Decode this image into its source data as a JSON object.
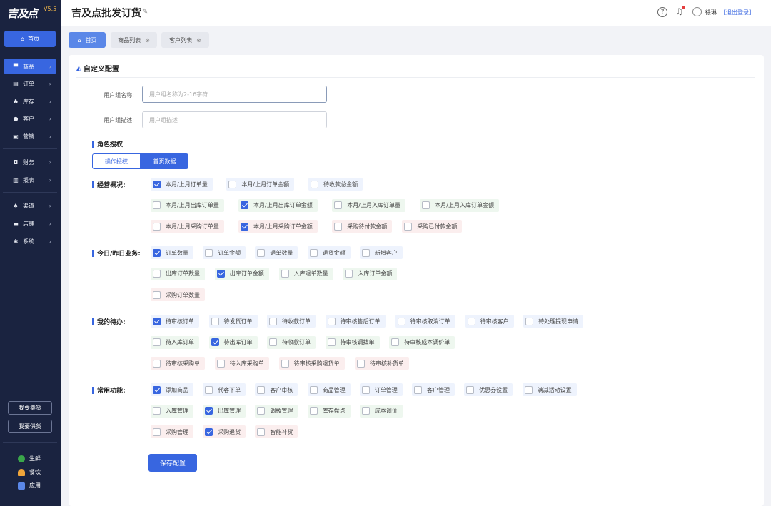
{
  "app": {
    "logo": "吉及点",
    "version": "V5.5"
  },
  "header": {
    "title": "吉及点批发订货",
    "user": "徐琳",
    "logout": "【退出登录】"
  },
  "sidebar": {
    "home": "首页",
    "items": [
      {
        "label": "商品",
        "icon": "cart-icon"
      },
      {
        "label": "订单",
        "icon": "order-icon"
      },
      {
        "label": "库存",
        "icon": "stock-icon"
      },
      {
        "label": "客户",
        "icon": "customer-icon"
      },
      {
        "label": "营销",
        "icon": "marketing-icon"
      },
      {
        "label": "财务",
        "icon": "finance-icon"
      },
      {
        "label": "报表",
        "icon": "report-icon"
      },
      {
        "label": "渠道",
        "icon": "channel-icon"
      },
      {
        "label": "店铺",
        "icon": "shop-icon"
      },
      {
        "label": "系统",
        "icon": "settings-icon"
      }
    ],
    "buttons": [
      "我要卖货",
      "我要供货"
    ],
    "apps": [
      "生鲜",
      "餐饮",
      "应用"
    ]
  },
  "tabs": [
    {
      "label": "首页"
    },
    {
      "label": "商品列表"
    },
    {
      "label": "客户列表"
    }
  ],
  "card": {
    "title": "自定义配置",
    "form": {
      "name_label": "用户组名称:",
      "name_placeholder": "用户组名称为2-16字符",
      "desc_label": "用户组描述:",
      "desc_placeholder": "用户组描述"
    },
    "role_title": "角色授权",
    "segments": [
      "操作授权",
      "首页数据"
    ],
    "save": "保存配置"
  },
  "groups": [
    {
      "label": "经营概况:",
      "rows": [
        {
          "color": "blue",
          "items": [
            {
              "label": "本月/上月订单量",
              "checked": true
            },
            {
              "label": "本月/上月订单金额",
              "checked": false
            },
            {
              "label": "待收款总金额",
              "checked": false
            }
          ]
        },
        {
          "color": "green",
          "items": [
            {
              "label": "本月/上月出库订单量",
              "checked": false
            },
            {
              "label": "本月/上月出库订单金额",
              "checked": true
            },
            {
              "label": "本月/上月入库订单量",
              "checked": false
            },
            {
              "label": "本月/上月入库订单金额",
              "checked": false
            }
          ]
        },
        {
          "color": "red",
          "items": [
            {
              "label": "本月/上月采购订单量",
              "checked": false
            },
            {
              "label": "本月/上月采购订单金额",
              "checked": true
            },
            {
              "label": "采购待付款金额",
              "checked": false
            },
            {
              "label": "采购已付款金额",
              "checked": false
            }
          ]
        }
      ]
    },
    {
      "label": "今日/昨日业务:",
      "rows": [
        {
          "color": "blue",
          "items": [
            {
              "label": "订单数量",
              "checked": true
            },
            {
              "label": "订单金额",
              "checked": false
            },
            {
              "label": "退单数量",
              "checked": false
            },
            {
              "label": "退货金额",
              "checked": false
            },
            {
              "label": "新增客户",
              "checked": false
            }
          ]
        },
        {
          "color": "green",
          "items": [
            {
              "label": "出库订单数量",
              "checked": false
            },
            {
              "label": "出库订单金额",
              "checked": true
            },
            {
              "label": "入库退单数量",
              "checked": false
            },
            {
              "label": "入库订单金额",
              "checked": false
            }
          ]
        },
        {
          "color": "red",
          "items": [
            {
              "label": "采购订单数量",
              "checked": false
            }
          ]
        }
      ]
    },
    {
      "label": "我的待办:",
      "rows": [
        {
          "color": "blue",
          "items": [
            {
              "label": "待审核订单",
              "checked": true
            },
            {
              "label": "待发货订单",
              "checked": false
            },
            {
              "label": "待收款订单",
              "checked": false
            },
            {
              "label": "待审核售后订单",
              "checked": false
            },
            {
              "label": "待审核取消订单",
              "checked": false
            },
            {
              "label": "待审核客户",
              "checked": false
            },
            {
              "label": "待处理提现申请",
              "checked": false
            }
          ]
        },
        {
          "color": "green",
          "items": [
            {
              "label": "待入库订单",
              "checked": false
            },
            {
              "label": "待出库订单",
              "checked": true
            },
            {
              "label": "待收款订单",
              "checked": false
            },
            {
              "label": "待审核调拨单",
              "checked": false
            },
            {
              "label": "待审核成本调价单",
              "checked": false
            }
          ]
        },
        {
          "color": "red",
          "items": [
            {
              "label": "待审核采购单",
              "checked": false
            },
            {
              "label": "待入库采购单",
              "checked": false
            },
            {
              "label": "待审核采购退货单",
              "checked": false
            },
            {
              "label": "待审核补货单",
              "checked": false
            }
          ]
        }
      ]
    },
    {
      "label": "常用功能:",
      "rows": [
        {
          "color": "blue",
          "items": [
            {
              "label": "添加商品",
              "checked": true
            },
            {
              "label": "代客下单",
              "checked": false
            },
            {
              "label": "客户审核",
              "checked": false
            },
            {
              "label": "商品管理",
              "checked": false
            },
            {
              "label": "订单管理",
              "checked": false
            },
            {
              "label": "客户管理",
              "checked": false
            },
            {
              "label": "优惠券设置",
              "checked": false
            },
            {
              "label": "满减活动设置",
              "checked": false
            }
          ]
        },
        {
          "color": "green",
          "items": [
            {
              "label": "入库管理",
              "checked": false
            },
            {
              "label": "出库管理",
              "checked": true
            },
            {
              "label": "调拨管理",
              "checked": false
            },
            {
              "label": "库存盘点",
              "checked": false
            },
            {
              "label": "成本调价",
              "checked": false
            }
          ]
        },
        {
          "color": "red",
          "items": [
            {
              "label": "采购管理",
              "checked": false
            },
            {
              "label": "采购退货",
              "checked": true
            },
            {
              "label": "智能补货",
              "checked": false
            }
          ]
        }
      ]
    }
  ]
}
